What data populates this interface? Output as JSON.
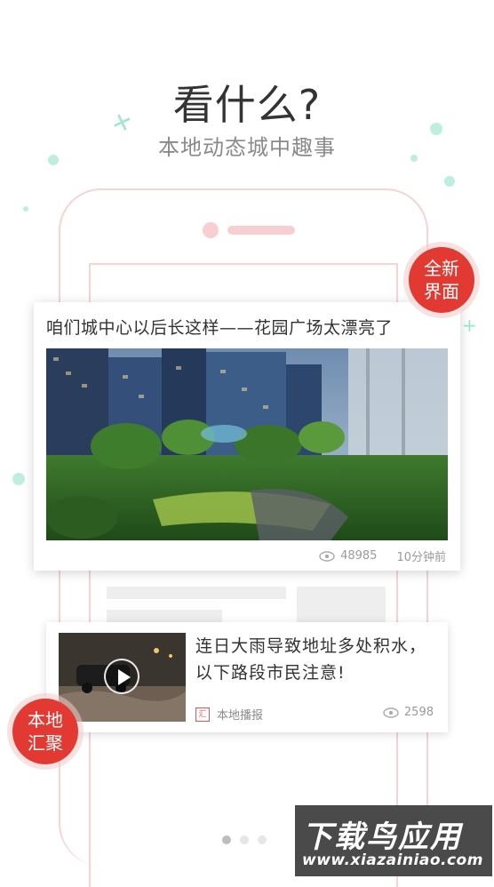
{
  "header": {
    "headline": "看什么?",
    "subtitle": "本地动态城中趣事"
  },
  "badges": {
    "new_ui": "全新界面",
    "local": "本地汇聚"
  },
  "featured_card": {
    "title": "咱们城中心以后长这样——花园广场太漂亮了",
    "views": "48985",
    "time": "10分钟前"
  },
  "second_card": {
    "title": "连日大雨导致地址多处积水，以下路段市民注意!",
    "source_icon": "汇",
    "source": "本地播报",
    "views": "2598"
  },
  "pager": {
    "count": 3,
    "active": 0
  },
  "watermark": {
    "title": "下载鸟应用",
    "url": "www.xiazainiao.com"
  },
  "colors": {
    "accent_red": "#e23a32",
    "mint": "#bfeee0",
    "phone_outline": "#f6d3d5"
  }
}
